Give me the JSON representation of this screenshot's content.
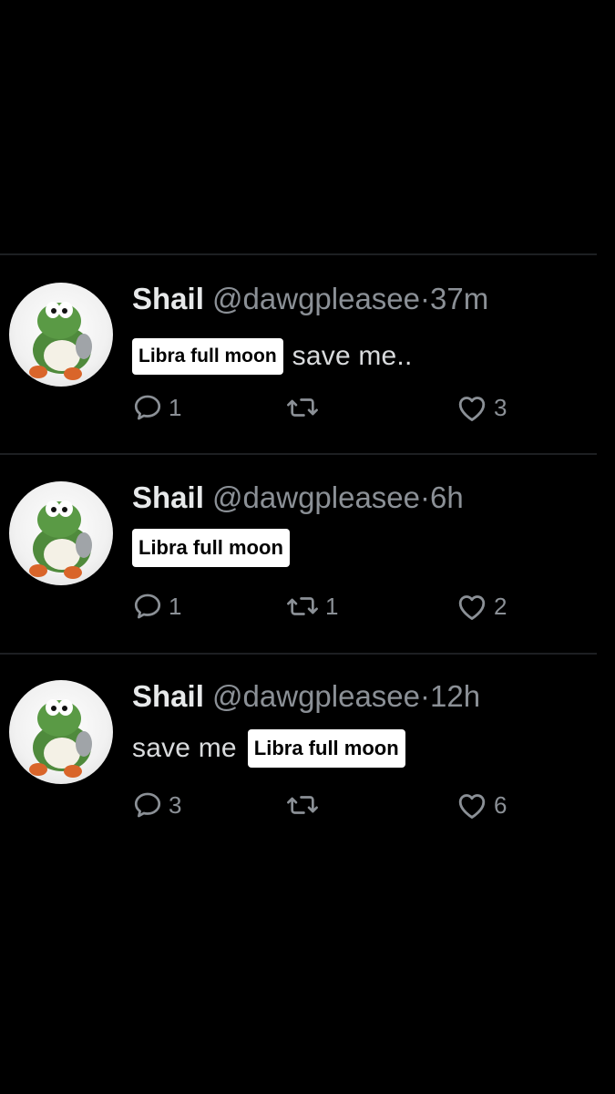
{
  "tweets": [
    {
      "name": "Shail",
      "handle": "@dawgpleasee",
      "separator": "·",
      "time": "37m",
      "caption": "Libra full moon",
      "text_before": "",
      "text_after": "save me..",
      "replies": "1",
      "retweets": "",
      "likes": "3"
    },
    {
      "name": "Shail",
      "handle": "@dawgpleasee",
      "separator": "·",
      "time": "6h",
      "caption": "Libra full moon",
      "text_before": "",
      "text_after": "",
      "replies": "1",
      "retweets": "1",
      "likes": "2"
    },
    {
      "name": "Shail",
      "handle": "@dawgpleasee",
      "separator": "·",
      "time": "12h",
      "caption": "Libra full moon",
      "text_before": "save me",
      "text_after": "",
      "replies": "3",
      "retweets": "",
      "likes": "6"
    }
  ],
  "icons": {
    "reply": "reply-icon",
    "retweet": "retweet-icon",
    "like": "heart-icon",
    "avatar": "yoshi-avatar"
  },
  "colors": {
    "background": "#000000",
    "muted": "#8b9096",
    "text": "#e7e9ea",
    "caption_bg": "#ffffff"
  }
}
